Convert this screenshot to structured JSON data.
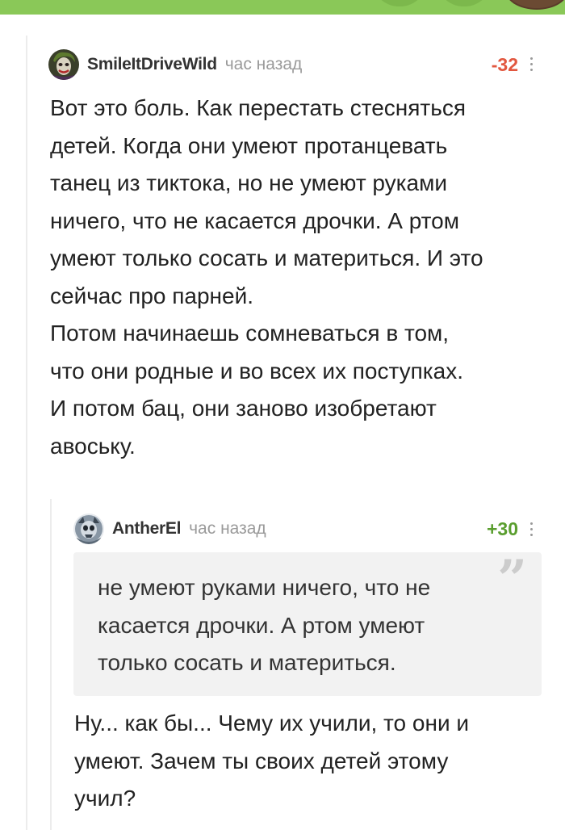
{
  "comment1": {
    "username": "SmileItDriveWild",
    "time": "час назад",
    "rating": "-32",
    "lines": [
      "Вот это боль. Как перестать стесняться",
      "детей. Когда они умеют протанцевать",
      "танец из тиктока, но не умеют руками",
      "ничего, что не касается дрочки. А ртом",
      "умеют только сосать и материться. И это",
      "сейчас про парней.",
      "Потом начинаешь сомневаться в том,",
      "что они родные и во всех их поступках.",
      "И потом бац, они заново изобретают",
      "авоську."
    ]
  },
  "comment2": {
    "username": "AntherEl",
    "time": "час назад",
    "rating": "+30",
    "quote_lines": [
      "не умеют руками ничего, что не",
      "касается дрочки. А ртом умеют",
      "только сосать и материться."
    ],
    "quote_mark": "”",
    "lines": [
      "Ну... как бы... Чему их учили, то они и",
      "умеют. Зачем ты своих детей этому",
      "учил?"
    ]
  },
  "colors": {
    "accent_bar": "#8ac858",
    "rating_negative": "#e2573f",
    "rating_positive": "#5a9e2f"
  },
  "icons": [
    "more-options-icon",
    "quote-mark-icon"
  ]
}
